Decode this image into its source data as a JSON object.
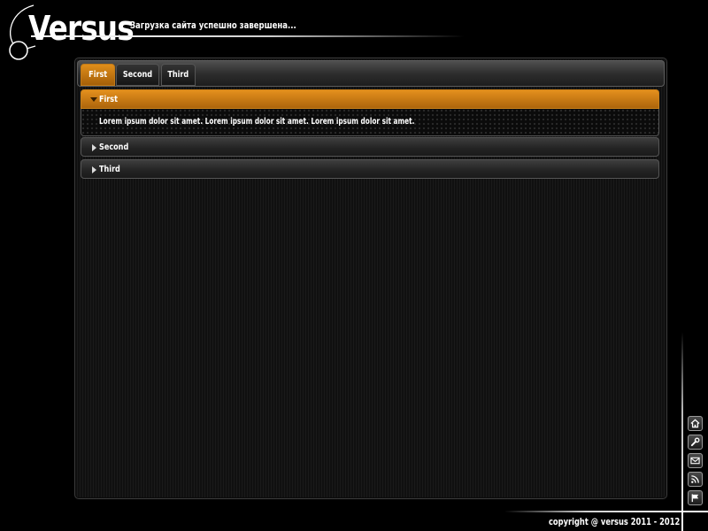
{
  "header": {
    "logo_text": "Versus",
    "status_message": "Загрузка сайта успешно завершена..."
  },
  "tabs": [
    {
      "label": "First",
      "active": true
    },
    {
      "label": "Second",
      "active": false
    },
    {
      "label": "Third",
      "active": false
    }
  ],
  "accordion": {
    "items": [
      {
        "label": "First",
        "expanded": true,
        "content": "Lorem ipsum dolor sit amet. Lorem ipsum dolor sit amet. Lorem ipsum dolor sit amet."
      },
      {
        "label": "Second",
        "expanded": false
      },
      {
        "label": "Third",
        "expanded": false
      }
    ]
  },
  "side_icons": [
    "home-icon",
    "wrench-icon",
    "mail-icon",
    "rss-icon",
    "flag-icon"
  ],
  "footer": {
    "copyright": "copyright @ versus 2011 - 2012"
  },
  "colors": {
    "accent": "#d2841a",
    "background": "#000000",
    "panel": "#141414"
  }
}
